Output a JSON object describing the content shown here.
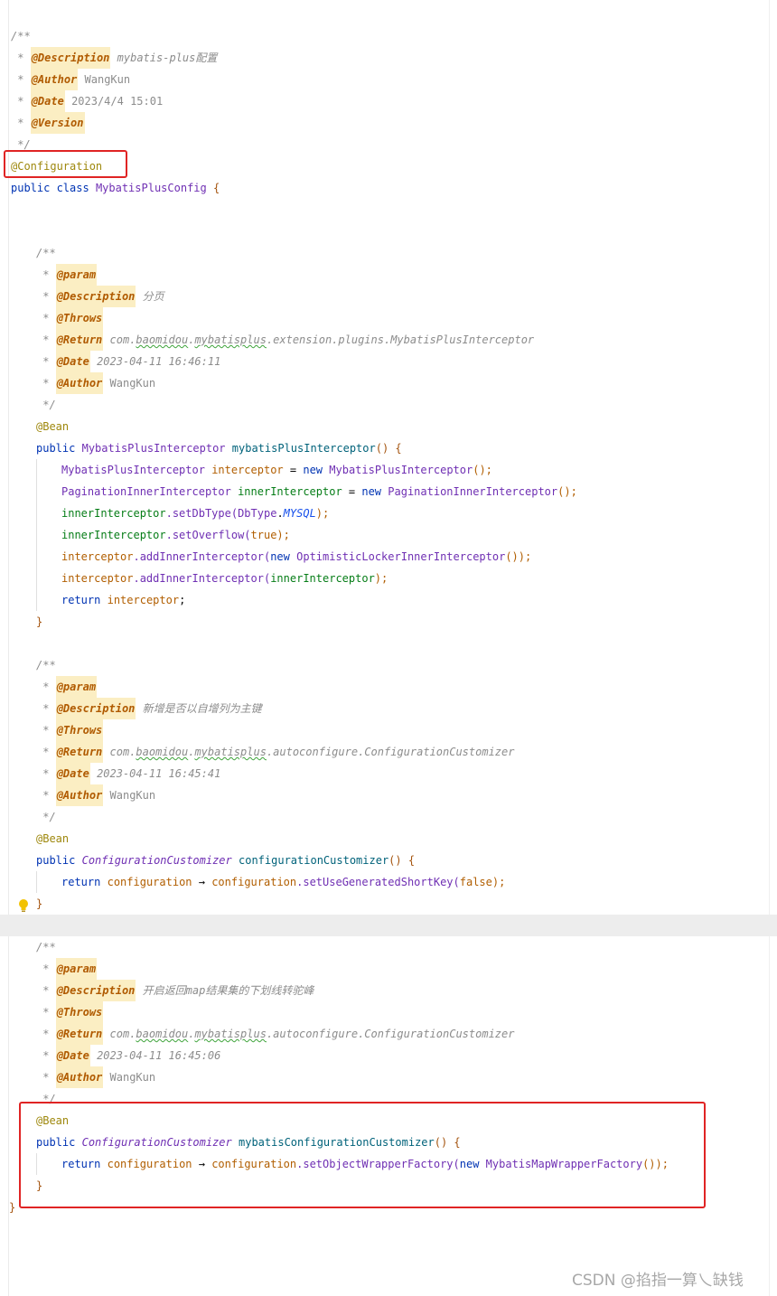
{
  "code": {
    "class_doc": {
      "open": "/**",
      "desc_tag": "@Description",
      "desc_val": "mybatis-plus配置",
      "author_tag": "@Author",
      "author_val": "WangKun",
      "date_tag": "@Date",
      "date_val": "2023/4/4 15:01",
      "version_tag": "@Version",
      "close": "*/"
    },
    "class_annotation": "@Configuration",
    "class_decl": {
      "kw": "public class",
      "name": "MybatisPlusConfig",
      "brace": "{"
    },
    "method1": {
      "doc": {
        "open": "/**",
        "param": "@param",
        "desc_tag": "@Description",
        "desc_val": "分页",
        "throws": "@Throws",
        "return_tag": "@Return",
        "return_pkg1": "com.",
        "return_pkg2": "baomidou",
        "return_pkg3": ".",
        "return_pkg4": "mybatisplus",
        "return_pkg5": ".extension.plugins.MybatisPlusInterceptor",
        "date_tag": "@Date",
        "date_val": "2023-04-11 16:46:11",
        "author_tag": "@Author",
        "author_val": "WangKun",
        "close": "*/"
      },
      "annotation": "@Bean",
      "sig_kw": "public",
      "sig_type": "MybatisPlusInterceptor",
      "sig_name": "mybatisPlusInterceptor",
      "sig_rest": "() {",
      "l1_type": "MybatisPlusInterceptor",
      "l1_var": "interceptor",
      "l1_eq": " = ",
      "l1_new": "new",
      "l1_cls": "MybatisPlusInterceptor",
      "l1_end": "();",
      "l2_type": "PaginationInnerInterceptor",
      "l2_var": "innerInterceptor",
      "l2_eq": " = ",
      "l2_new": "new",
      "l2_cls": "PaginationInnerInterceptor",
      "l2_end": "();",
      "l3_var": "innerInterceptor",
      "l3_call": ".setDbType(",
      "l3_cls": "DbType",
      "l3_dot": ".",
      "l3_const": "MYSQL",
      "l3_end": ");",
      "l4_var": "innerInterceptor",
      "l4_call": ".setOverflow(",
      "l4_val": "true",
      "l4_end": ");",
      "l5_var": "interceptor",
      "l5_call": ".addInnerInterceptor(",
      "l5_new": "new",
      "l5_cls": "OptimisticLockerInnerInterceptor",
      "l5_end": "());",
      "l6_var": "interceptor",
      "l6_call": ".addInnerInterceptor(",
      "l6_arg": "innerInterceptor",
      "l6_end": ");",
      "l7_kw": "return",
      "l7_var": "interceptor",
      "l7_end": ";",
      "close": "}"
    },
    "method2": {
      "doc": {
        "open": "/**",
        "param": "@param",
        "desc_tag": "@Description",
        "desc_val": "新增是否以自增列为主键",
        "throws": "@Throws",
        "return_tag": "@Return",
        "return_pkg1": "com.",
        "return_pkg2": "baomidou",
        "return_pkg3": ".",
        "return_pkg4": "mybatisplus",
        "return_pkg5": ".autoconfigure.ConfigurationCustomizer",
        "date_tag": "@Date",
        "date_val": "2023-04-11 16:45:41",
        "author_tag": "@Author",
        "author_val": "WangKun",
        "close": "*/"
      },
      "annotation": "@Bean",
      "sig_kw": "public",
      "sig_type": "ConfigurationCustomizer",
      "sig_name": "configurationCustomizer",
      "sig_rest": "() {",
      "l1_kw": "return",
      "l1_param": "configuration",
      "l1_arrow": " → ",
      "l1_obj": "configuration",
      "l1_call": ".setUseGeneratedShortKey(",
      "l1_val": "false",
      "l1_end": ");",
      "close": "}"
    },
    "method3": {
      "doc": {
        "open": "/**",
        "param": "@param",
        "desc_tag": "@Description",
        "desc_val": "开启返回map结果集的下划线转驼峰",
        "throws": "@Throws",
        "return_tag": "@Return",
        "return_pkg1": "com.",
        "return_pkg2": "baomidou",
        "return_pkg3": ".",
        "return_pkg4": "mybatisplus",
        "return_pkg5": ".autoconfigure.ConfigurationCustomizer",
        "date_tag": "@Date",
        "date_val": "2023-04-11 16:45:06",
        "author_tag": "@Author",
        "author_val": "WangKun",
        "close": "*/"
      },
      "annotation": "@Bean",
      "sig_kw": "public",
      "sig_type": "ConfigurationCustomizer",
      "sig_name": "mybatisConfigurationCustomizer",
      "sig_rest": "() {",
      "l1_kw": "return",
      "l1_param": "configuration",
      "l1_arrow": " → ",
      "l1_obj": "configuration",
      "l1_call": ".setObjectWrapperFactory(",
      "l1_new": "new",
      "l1_cls": "MybatisMapWrapperFactory",
      "l1_end": "());",
      "close": "}"
    },
    "class_close": "}",
    "star": "*"
  },
  "watermark": "CSDN @掐指一算乀缺钱",
  "colors": {
    "highlight_box": "#e02424",
    "doc_tag_bg": "#fbeec3",
    "doc_tag_fg": "#b05a00",
    "keyword": "#0033b3",
    "class_name": "#6f2fb3",
    "comment": "#8c8c8c"
  },
  "icons": {
    "intention": "lightbulb-icon"
  }
}
